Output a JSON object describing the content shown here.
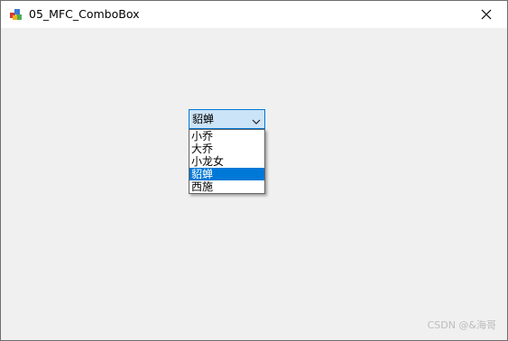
{
  "window": {
    "title": "05_MFC_ComboBox",
    "close_glyph": "✕"
  },
  "combobox": {
    "selected_value": "貂蝉",
    "options": [
      "小乔",
      "大乔",
      "小龙女",
      "貂蝉",
      "西施"
    ],
    "selected_index": 3,
    "accent_color": "#0078d7"
  },
  "watermark": "CSDN @&海哥"
}
